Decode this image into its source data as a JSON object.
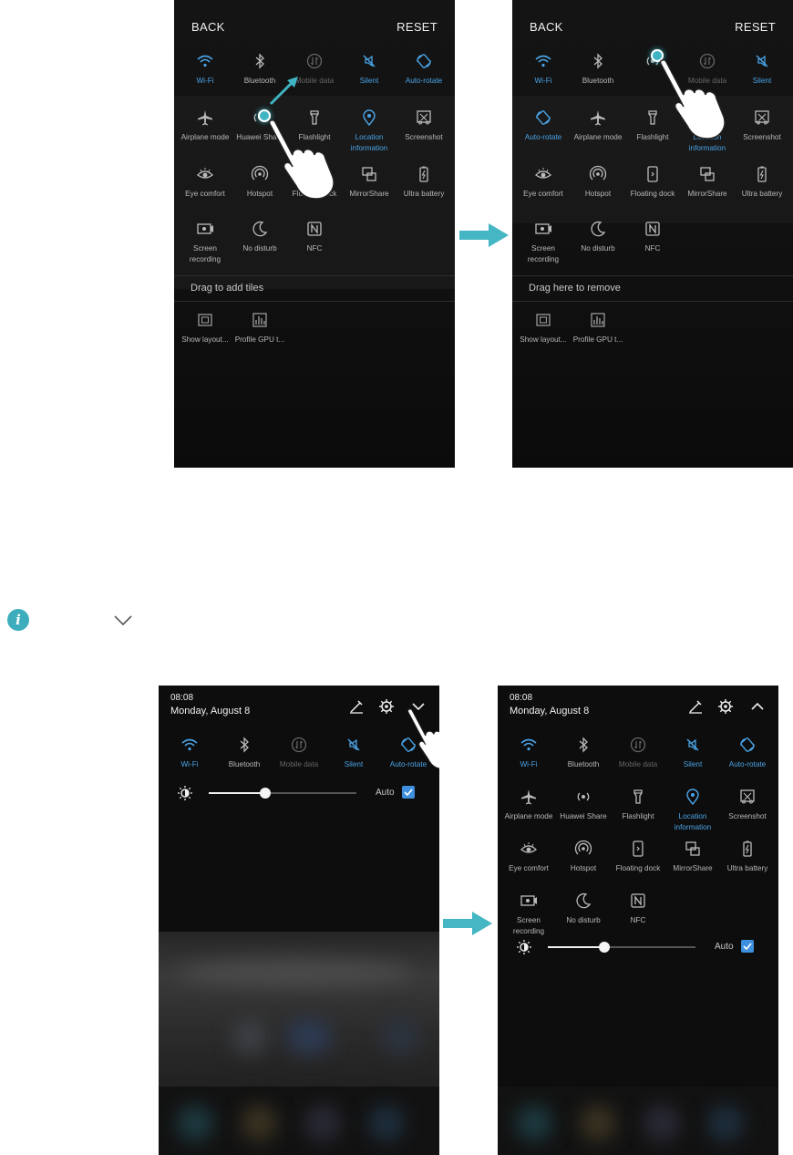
{
  "edit": {
    "back_label": "BACK",
    "reset_label": "RESET",
    "drag_add_label": "Drag to add tiles",
    "drag_remove_label": "Drag here to remove"
  },
  "tiles": {
    "wifi": "Wi-Fi",
    "bluetooth": "Bluetooth",
    "mobile_data": "Mobile data",
    "silent": "Silent",
    "auto_rotate": "Auto-rotate",
    "airplane": "Airplane mode",
    "huawei_share": "Huawei Share",
    "flashlight": "Flashlight",
    "location": "Location information",
    "screenshot": "Screenshot",
    "eye_comfort": "Eye comfort",
    "hotspot": "Hotspot",
    "floating_dock": "Floating dock",
    "mirrorshare": "MirrorShare",
    "ultra_battery": "Ultra battery",
    "screen_recording": "Screen recording",
    "no_disturb": "No disturb",
    "nfc": "NFC",
    "show_layout": "Show layout...",
    "profile_gpu": "Profile GPU t..."
  },
  "shade": {
    "time": "08:08",
    "date": "Monday, August 8",
    "auto_label": "Auto",
    "brightness_level": 0.38
  },
  "icons": {
    "info": "i"
  },
  "colors": {
    "active_blue": "#4aa3e6",
    "touch_teal": "#3fb5c4",
    "arrow_teal": "#45b6c3"
  }
}
